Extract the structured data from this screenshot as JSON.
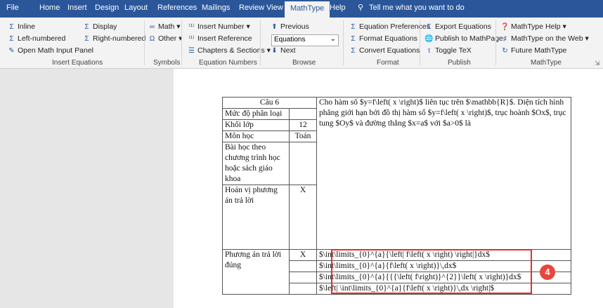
{
  "tabs": [
    "File",
    "Home",
    "Insert",
    "Design",
    "Layout",
    "References",
    "Mailings",
    "Review",
    "View",
    "MathType",
    "Help",
    "Tell me what you want to do"
  ],
  "ribbon": {
    "insert_equations": {
      "inline": "Inline",
      "display": "Display",
      "left_numbered": "Left-numbered",
      "right_numbered": "Right-numbered",
      "open_panel": "Open Math Input Panel",
      "label": "Insert Equations"
    },
    "symbols": {
      "math": "Math",
      "other": "Other",
      "label": "Symbols"
    },
    "equation_numbers": {
      "insert_number": "Insert Number",
      "insert_reference": "Insert Reference",
      "chapters_sections": "Chapters & Sections",
      "label": "Equation Numbers"
    },
    "browse": {
      "previous": "Previous",
      "combo_value": "Equations",
      "next": "Next",
      "label": "Browse"
    },
    "format": {
      "equation_preferences": "Equation Preferences",
      "format_equations": "Format Equations",
      "convert_equations": "Convert Equations",
      "label": "Format"
    },
    "publish": {
      "export_equations": "Export Equations",
      "publish_mathpage": "Publish to MathPage",
      "toggle_tex": "Toggle TeX",
      "label": "Publish"
    },
    "mathtype": {
      "help": "MathType Help",
      "on_web": "MathType on the Web",
      "future": "Future MathType",
      "label": "MathType"
    }
  },
  "table": {
    "cau": "Câu 6",
    "muc_do": "Mức độ phân loại",
    "khoi_lop_label": "Khối lớp",
    "khoi_lop_value": "12",
    "mon_hoc_label": "Môn học",
    "mon_hoc_value": "Toán",
    "bai_hoc_label": "Bài học theo chương trình học hoặc sách giáo khoa",
    "hoan_vi_label": "Hoán vị phương án trả lời",
    "hoan_vi_value": "X",
    "question": "Cho hàm số $y=f\\left( x \\right)$ liên tục trên $\\mathbb{R}$. Diện tích hình phẳng giới hạn bởi đồ thị hàm số $y=f\\left( x \\right)$, trục hoành $Ox$, trục tung $Oy$ và đường thẳng $x=a$  với  $a>0$ là",
    "phuong_an_label": "Phương án trả lời đúng",
    "phuong_an_value": "X",
    "answers": [
      "$\\int\\limits_{0}^{a}{\\left| f\\left( x \\right) \\right|}dx$",
      "$\\int\\limits_{0}^{a}{f\\left( x \\right)}\\,dx$",
      "$\\int\\limits_{0}^{a}{{{\\left( f\\right)}^{2}}\\left( x \\right)}dx$",
      "$\\left| \\int\\limits_{0}^{a}{f\\left( x \\right)}\\,dx \\right|$"
    ]
  },
  "badge": "4"
}
